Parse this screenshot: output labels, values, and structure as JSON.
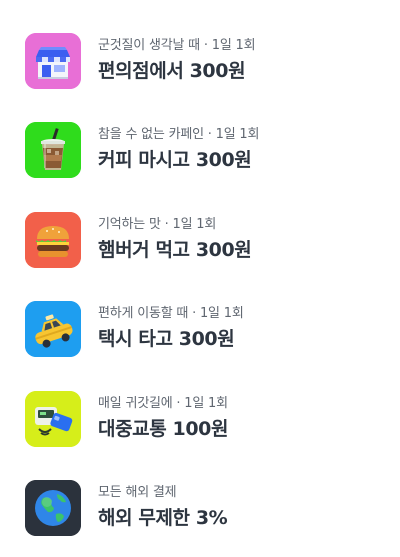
{
  "benefits": [
    {
      "caption": "군것질이 생각날 때 · 1일 1회",
      "title": "편의점에서 300원",
      "icon": "convenience-store-icon",
      "tile_color": "#e86fd6"
    },
    {
      "caption": "참을 수 없는 카페인 · 1일 1회",
      "title": "커피 마시고 300원",
      "icon": "iced-coffee-icon",
      "tile_color": "#2fdc1c"
    },
    {
      "caption": "기억하는 맛 · 1일 1회",
      "title": "햄버거 먹고 300원",
      "icon": "hamburger-icon",
      "tile_color": "#f2604a"
    },
    {
      "caption": "편하게 이동할 때 · 1일 1회",
      "title": "택시 타고 300원",
      "icon": "taxi-icon",
      "tile_color": "#1e9ef0"
    },
    {
      "caption": "매일 귀갓길에 · 1일 1회",
      "title": "대중교통 100원",
      "icon": "transit-card-icon",
      "tile_color": "#d6ee1a"
    },
    {
      "caption": "모든 해외 결제",
      "title": "해외 무제한 3%",
      "icon": "globe-icon",
      "tile_color": "#2b323c"
    }
  ]
}
